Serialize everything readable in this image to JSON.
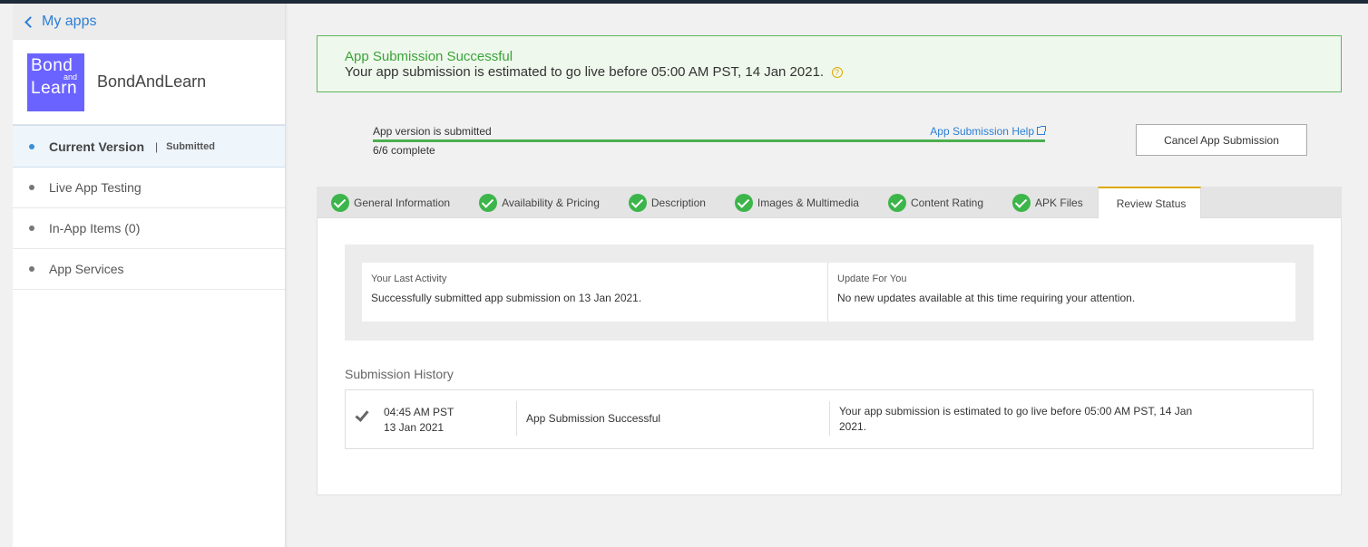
{
  "sidebar": {
    "back_label": "My apps",
    "logo": {
      "line1": "Bond",
      "line2": "and",
      "line3": "Learn"
    },
    "app_name": "BondAndLearn",
    "current_version": {
      "label": "Current Version",
      "separator": "|",
      "status": "Submitted"
    },
    "items": [
      {
        "label": "Live App Testing"
      },
      {
        "label": "In-App Items (0)"
      },
      {
        "label": "App Services"
      }
    ]
  },
  "banner": {
    "title": "App Submission Successful",
    "message": "Your app submission is estimated to go live before 05:00 AM PST, 14 Jan 2021.",
    "help_glyph": "?"
  },
  "progress": {
    "status": "App version is submitted",
    "help_link": "App Submission Help",
    "count": "6/6 complete",
    "fraction": 1.0
  },
  "cancel_button": "Cancel App Submission",
  "tabs": [
    {
      "label": "General Information",
      "complete": true
    },
    {
      "label": "Availability & Pricing",
      "complete": true
    },
    {
      "label": "Description",
      "complete": true
    },
    {
      "label": "Images & Multimedia",
      "complete": true
    },
    {
      "label": "Content Rating",
      "complete": true
    },
    {
      "label": "APK Files",
      "complete": true
    },
    {
      "label": "Review Status",
      "complete": false,
      "active": true
    }
  ],
  "activity": {
    "last_title": "Your Last Activity",
    "last_text": "Successfully submitted app submission on 13 Jan 2021.",
    "update_title": "Update For You",
    "update_text": "No new updates available at this time requiring your attention."
  },
  "history": {
    "title": "Submission History",
    "rows": [
      {
        "time": "04:45 AM PST",
        "date": "13 Jan 2021",
        "event": "App Submission Successful",
        "description": "Your app submission is estimated to go live before 05:00 AM PST, 14 Jan 2021."
      }
    ]
  },
  "colors": {
    "success_green": "#3aa33a",
    "link_blue": "#2d7fd3",
    "logo_purple": "#6b63ff",
    "active_tab_accent": "#e0a800"
  }
}
